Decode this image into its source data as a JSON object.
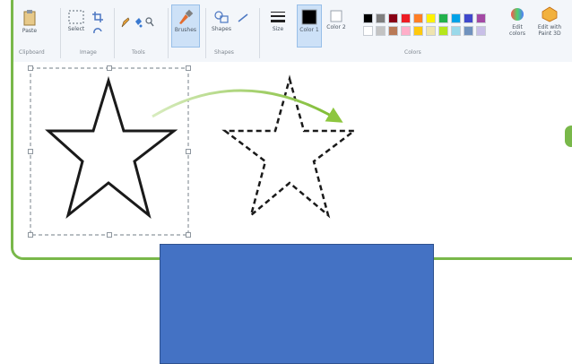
{
  "ribbon": {
    "groups": [
      {
        "id": "clipboard",
        "label": "Clipboard"
      },
      {
        "id": "image",
        "label": "Image"
      },
      {
        "id": "tools",
        "label": "Tools"
      },
      {
        "id": "shapes",
        "label": "Shapes"
      },
      {
        "id": "colors",
        "label": "Colors"
      }
    ],
    "buttons": {
      "paste": "Paste",
      "select": "Select",
      "brushes": "Brushes",
      "shapes": "Shapes",
      "size": "Size",
      "color1": "Color 1",
      "color2": "Color 2",
      "edit_colors": "Edit colors",
      "edit_paint3d": "Edit with Paint 3D"
    },
    "palette": [
      "#000000",
      "#7f7f7f",
      "#880015",
      "#ed1c24",
      "#ff7f27",
      "#fff200",
      "#22b14c",
      "#00a2e8",
      "#3f48cc",
      "#a349a4",
      "#ffffff",
      "#c3c3c3",
      "#b97a57",
      "#ffaec9",
      "#ffc90e",
      "#efe4b0",
      "#b5e61d",
      "#99d9ea",
      "#7092be",
      "#c8bfe7"
    ]
  },
  "colors": {
    "frame": "#79b84a",
    "arrow": "#8dc63f",
    "shape_fill": "#4472c4",
    "star_stroke": "#1a1a1a",
    "selection": "#8e969e"
  },
  "icons": [
    "paste-icon",
    "select-icon",
    "crop-icon",
    "pencil-icon",
    "fill-icon",
    "text-icon",
    "eraser-icon",
    "picker-icon",
    "magnifier-icon",
    "brush-icon",
    "shapes-icon",
    "size-icon",
    "color-swatch-icon",
    "edit-colors-icon",
    "paint3d-icon"
  ]
}
